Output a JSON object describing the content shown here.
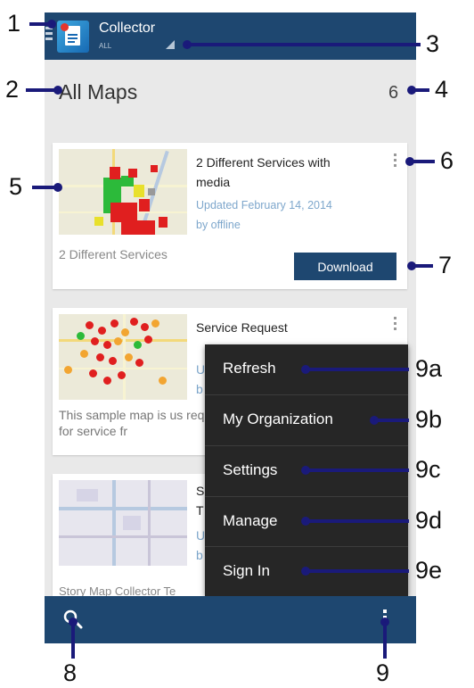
{
  "app": {
    "title": "Collector",
    "filter": "ALL"
  },
  "header": {
    "title": "All Maps",
    "count": "6"
  },
  "maps": [
    {
      "title": "2 Different Services with media",
      "updated": "Updated February 14, 2014",
      "owner": "by offline",
      "description": "2 Different Services",
      "action": "Download"
    },
    {
      "title": "Service Request",
      "updated_fragment": "U",
      "owner_fragment": "b",
      "description": "This sample map is us requests for service fr"
    },
    {
      "title_fragment_1": "S",
      "title_fragment_2": "T",
      "updated_fragment": "U",
      "owner_fragment": "b",
      "description": "Story Map Collector Te"
    }
  ],
  "menu": {
    "items": [
      "Refresh",
      "My Organization",
      "Settings",
      "Manage",
      "Sign In"
    ]
  },
  "icons": {
    "menu": "hamburger-icon",
    "app": "collector-app-icon",
    "filter": "dropdown-triangle-icon",
    "card_overflow": "kebab-icon",
    "search": "search-icon",
    "overflow": "kebab-icon"
  },
  "colors": {
    "bar": "#1e4770",
    "menu_bg": "#262626",
    "content_bg": "#e9e9e9",
    "link": "#7ea7cc",
    "callout_line": "#1a1a7a"
  },
  "callouts": {
    "c1": "1",
    "c2": "2",
    "c3": "3",
    "c4": "4",
    "c5": "5",
    "c6a": "6",
    "c6b": "6",
    "c7": "7",
    "c8": "8",
    "c9": "9",
    "c9a": "9a",
    "c9b": "9b",
    "c9c": "9c",
    "c9d": "9d",
    "c9e": "9e"
  }
}
